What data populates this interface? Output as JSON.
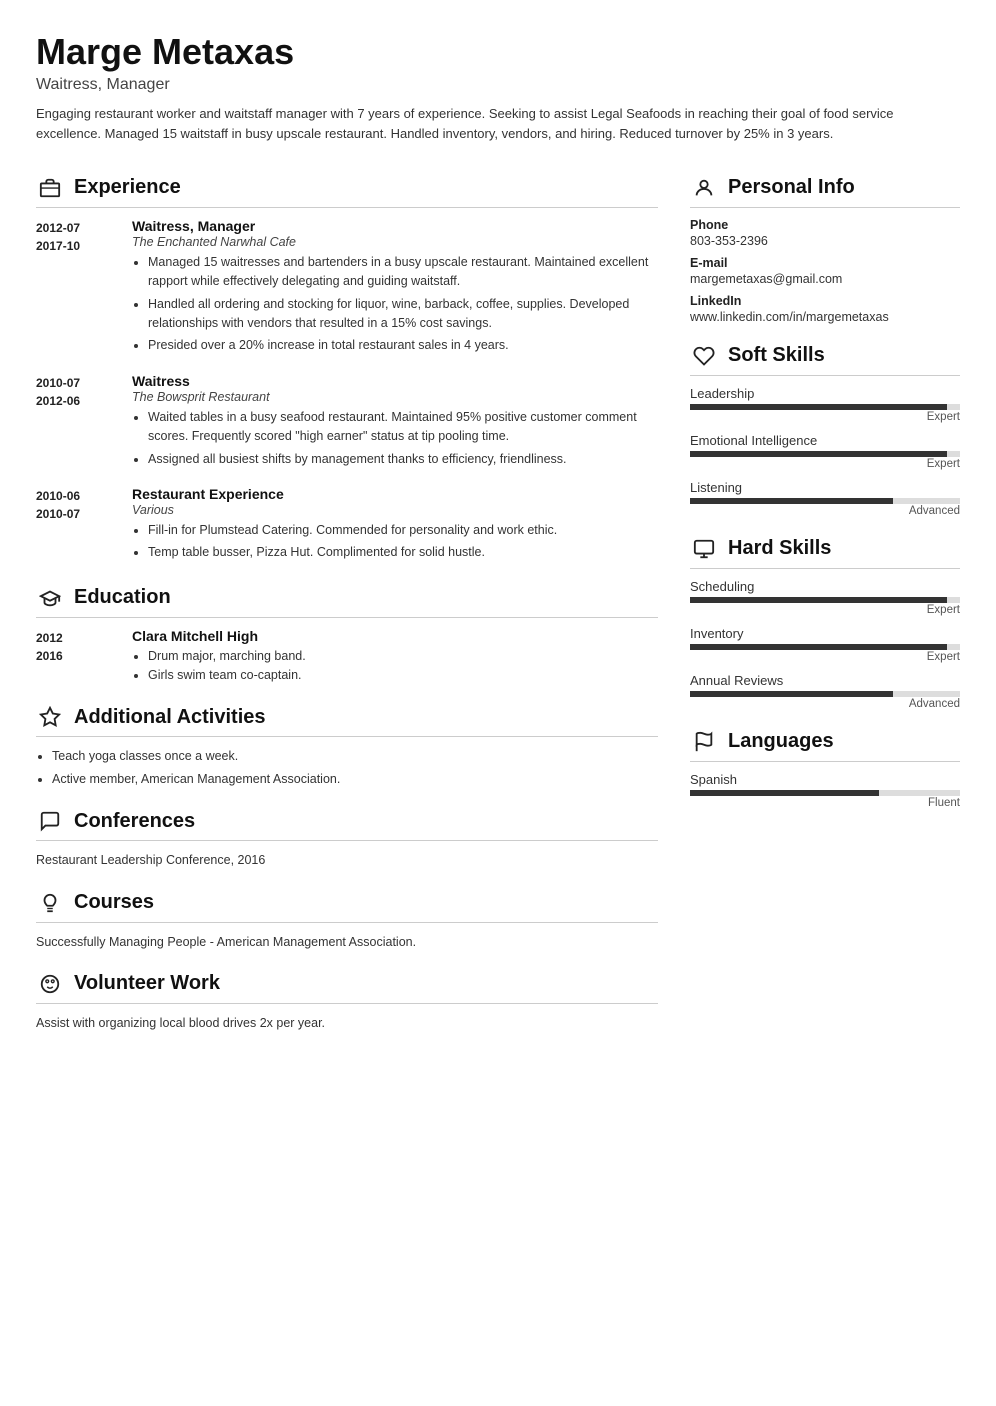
{
  "header": {
    "name": "Marge Metaxas",
    "title": "Waitress, Manager",
    "summary": "Engaging restaurant worker and waitstaff manager with 7 years of experience. Seeking to assist Legal Seafoods in reaching their goal of food service excellence. Managed 15 waitstaff in busy upscale restaurant. Handled inventory, vendors, and hiring. Reduced turnover by 25% in 3 years."
  },
  "sections": {
    "experience_label": "Experience",
    "education_label": "Education",
    "additional_label": "Additional Activities",
    "conferences_label": "Conferences",
    "courses_label": "Courses",
    "volunteer_label": "Volunteer Work",
    "personal_label": "Personal Info",
    "soft_skills_label": "Soft Skills",
    "hard_skills_label": "Hard Skills",
    "languages_label": "Languages"
  },
  "experience": [
    {
      "dates": "2012-07 - 2017-10",
      "job_title": "Waitress, Manager",
      "company": "The Enchanted Narwhal Cafe",
      "bullets": [
        "Managed 15 waitresses and bartenders in a busy upscale restaurant. Maintained excellent rapport while effectively delegating and guiding waitstaff.",
        "Handled all ordering and stocking for liquor, wine, barback, coffee, supplies. Developed relationships with vendors that resulted in a 15% cost savings.",
        "Presided over a 20% increase in total restaurant sales in 4 years."
      ]
    },
    {
      "dates": "2010-07 - 2012-06",
      "job_title": "Waitress",
      "company": "The Bowsprit Restaurant",
      "bullets": [
        "Waited tables in a busy seafood restaurant. Maintained 95% positive customer comment scores. Frequently scored \"high earner\" status at tip pooling time.",
        "Assigned all busiest shifts by management thanks to efficiency, friendliness."
      ]
    },
    {
      "dates": "2010-06 - 2010-07",
      "job_title": "Restaurant Experience",
      "company": "Various",
      "bullets": [
        "Fill-in for Plumstead Catering. Commended for personality and work ethic.",
        "Temp table busser, Pizza Hut. Complimented for solid hustle."
      ]
    }
  ],
  "education": [
    {
      "dates": "2012 - 2016",
      "school": "Clara Mitchell High",
      "bullets": [
        "Drum major, marching band.",
        "Girls swim team co-captain."
      ]
    }
  ],
  "additional": {
    "bullets": [
      "Teach yoga classes once a week.",
      "Active member, American Management Association."
    ]
  },
  "conferences": {
    "text": "Restaurant Leadership Conference, 2016"
  },
  "courses": {
    "text": "Successfully Managing People - American Management Association."
  },
  "volunteer": {
    "text": "Assist with organizing local blood drives 2x per year."
  },
  "personal_info": {
    "phone_label": "Phone",
    "phone": "803-353-2396",
    "email_label": "E-mail",
    "email": "margemetaxas@gmail.com",
    "linkedin_label": "LinkedIn",
    "linkedin": "www.linkedin.com/in/margemetaxas"
  },
  "soft_skills": [
    {
      "name": "Leadership",
      "level_label": "Expert",
      "pct": 95
    },
    {
      "name": "Emotional Intelligence",
      "level_label": "Expert",
      "pct": 95
    },
    {
      "name": "Listening",
      "level_label": "Advanced",
      "pct": 75
    }
  ],
  "hard_skills": [
    {
      "name": "Scheduling",
      "level_label": "Expert",
      "pct": 95
    },
    {
      "name": "Inventory",
      "level_label": "Expert",
      "pct": 95
    },
    {
      "name": "Annual Reviews",
      "level_label": "Advanced",
      "pct": 75
    }
  ],
  "languages": [
    {
      "name": "Spanish",
      "level_label": "Fluent",
      "pct": 70
    }
  ]
}
